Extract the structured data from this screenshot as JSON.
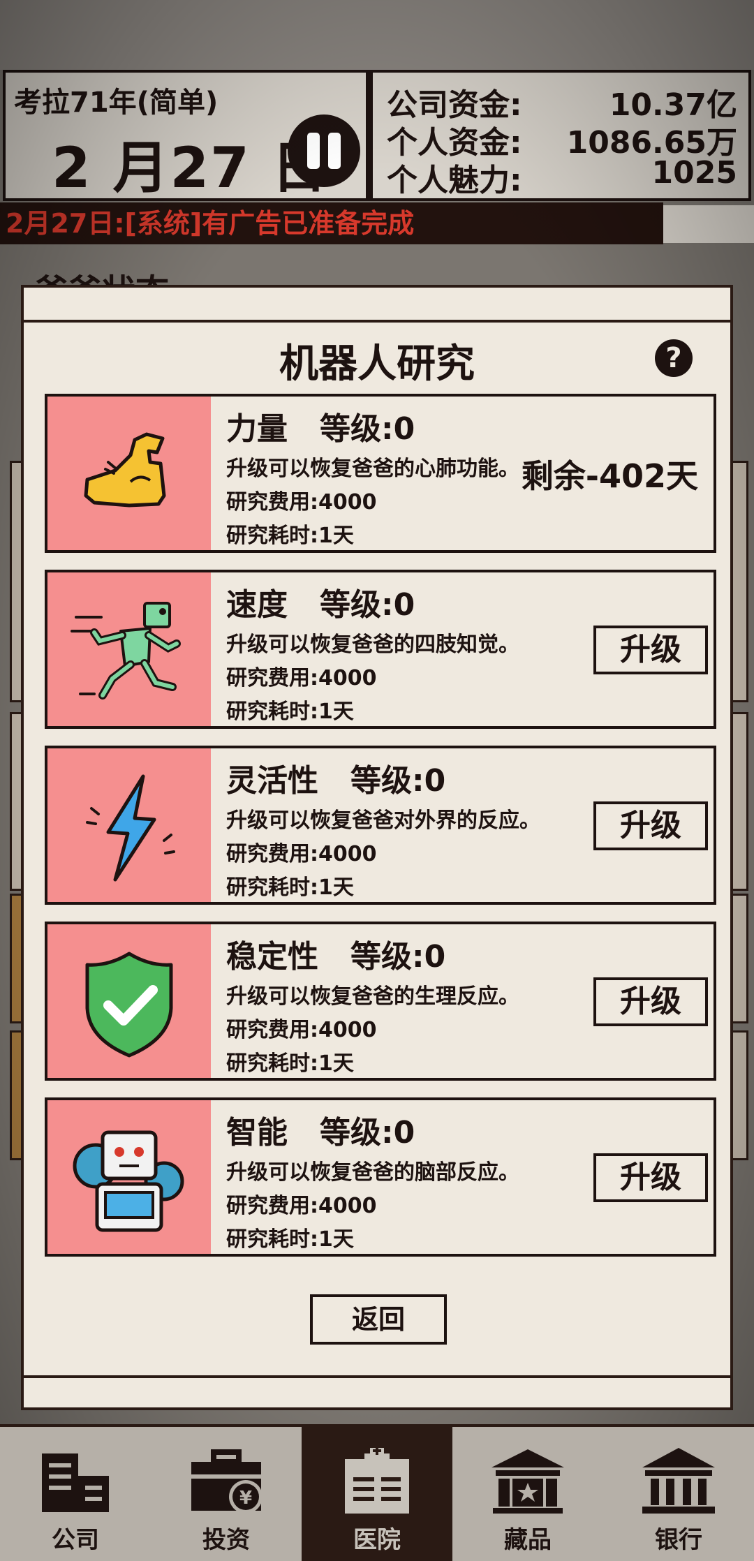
{
  "header": {
    "era": "考拉71年(简单)",
    "date": "2 月27 日",
    "company_funds_label": "公司资金:",
    "company_funds_value": "10.37亿",
    "personal_funds_label": "个人资金:",
    "personal_funds_value": "1086.65万",
    "charm_label": "个人魅力:",
    "charm_value": "1025"
  },
  "ticker": {
    "message": "2月27日:[系统]有广告已准备完成"
  },
  "background": {
    "section_title": "爸爸状态"
  },
  "modal": {
    "title": "机器人研究",
    "items": [
      {
        "name": "力量",
        "level": "等级:0",
        "desc": "升级可以恢复爸爸的心肺功能。",
        "cost": "研究费用:4000",
        "time": "研究耗时:1天",
        "remaining": "剩余-402天",
        "icon": "flexed-arm-icon"
      },
      {
        "name": "速度",
        "level": "等级:0",
        "desc": "升级可以恢复爸爸的四肢知觉。",
        "cost": "研究费用:4000",
        "time": "研究耗时:1天",
        "button": "升级",
        "icon": "running-robot-icon"
      },
      {
        "name": "灵活性",
        "level": "等级:0",
        "desc": "升级可以恢复爸爸对外界的反应。",
        "cost": "研究费用:4000",
        "time": "研究耗时:1天",
        "button": "升级",
        "icon": "lightning-icon"
      },
      {
        "name": "稳定性",
        "level": "等级:0",
        "desc": "升级可以恢复爸爸的生理反应。",
        "cost": "研究费用:4000",
        "time": "研究耗时:1天",
        "button": "升级",
        "icon": "shield-check-icon"
      },
      {
        "name": "智能",
        "level": "等级:0",
        "desc": "升级可以恢复爸爸的脑部反应。",
        "cost": "研究费用:4000",
        "time": "研究耗时:1天",
        "button": "升级",
        "icon": "robot-head-icon"
      }
    ],
    "back_label": "返回"
  },
  "nav": [
    {
      "label": "公司",
      "icon": "building-icon"
    },
    {
      "label": "投资",
      "icon": "briefcase-yen-icon"
    },
    {
      "label": "医院",
      "icon": "hospital-icon",
      "active": true
    },
    {
      "label": "藏品",
      "icon": "museum-star-icon"
    },
    {
      "label": "银行",
      "icon": "bank-icon"
    }
  ],
  "colors": {
    "dark": "#1d1210",
    "card_bg": "#efe9df",
    "icon_bg": "#f58f8f",
    "ticker_text": "#d7392c"
  }
}
